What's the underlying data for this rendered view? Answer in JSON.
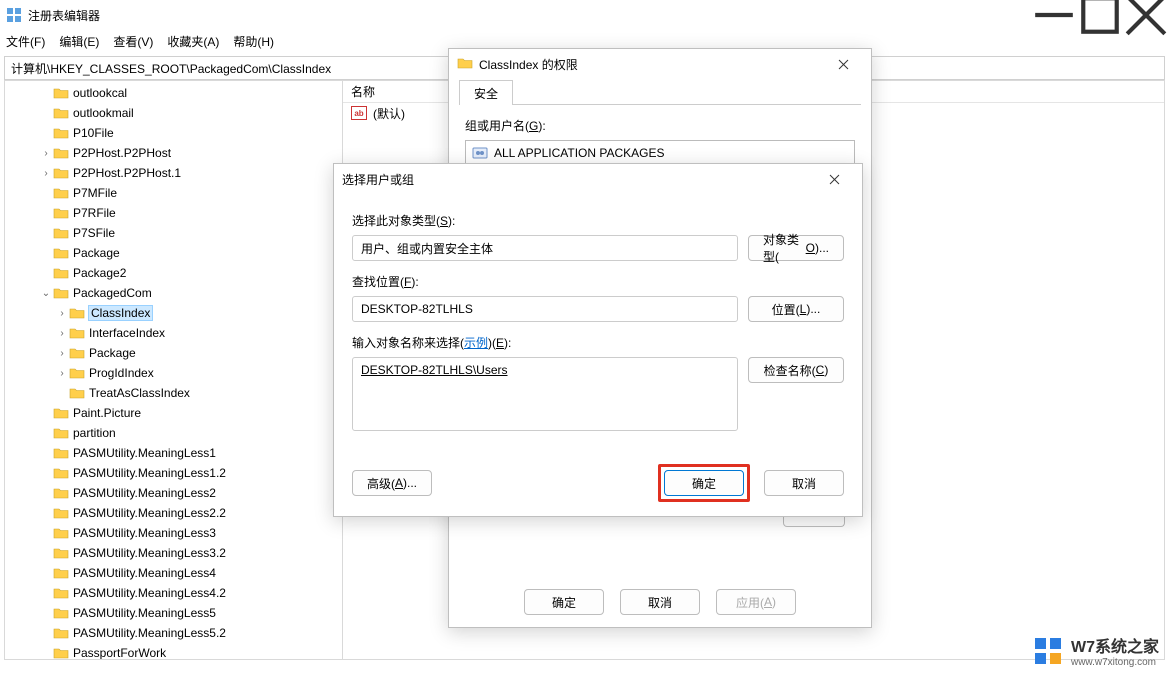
{
  "titlebar": {
    "title": "注册表编辑器"
  },
  "menubar": {
    "file": "文件(F)",
    "edit": "编辑(E)",
    "view": "查看(V)",
    "fav": "收藏夹(A)",
    "help": "帮助(H)"
  },
  "pathbar": {
    "path": "计算机\\HKEY_CLASSES_ROOT\\PackagedCom\\ClassIndex"
  },
  "values": {
    "col_name": "名称",
    "default_row": "(默认)"
  },
  "tree": {
    "items": [
      {
        "indent": 2,
        "exp": "",
        "label": "outlookcal"
      },
      {
        "indent": 2,
        "exp": "",
        "label": "outlookmail"
      },
      {
        "indent": 2,
        "exp": "",
        "label": "P10File"
      },
      {
        "indent": 2,
        "exp": ">",
        "label": "P2PHost.P2PHost"
      },
      {
        "indent": 2,
        "exp": ">",
        "label": "P2PHost.P2PHost.1"
      },
      {
        "indent": 2,
        "exp": "",
        "label": "P7MFile"
      },
      {
        "indent": 2,
        "exp": "",
        "label": "P7RFile"
      },
      {
        "indent": 2,
        "exp": "",
        "label": "P7SFile"
      },
      {
        "indent": 2,
        "exp": "",
        "label": "Package"
      },
      {
        "indent": 2,
        "exp": "",
        "label": "Package2"
      },
      {
        "indent": 2,
        "exp": "v",
        "label": "PackagedCom"
      },
      {
        "indent": 3,
        "exp": ">",
        "label": "ClassIndex",
        "selected": true
      },
      {
        "indent": 3,
        "exp": ">",
        "label": "InterfaceIndex"
      },
      {
        "indent": 3,
        "exp": ">",
        "label": "Package"
      },
      {
        "indent": 3,
        "exp": ">",
        "label": "ProgIdIndex"
      },
      {
        "indent": 3,
        "exp": "",
        "label": "TreatAsClassIndex"
      },
      {
        "indent": 2,
        "exp": "",
        "label": "Paint.Picture"
      },
      {
        "indent": 2,
        "exp": "",
        "label": "partition"
      },
      {
        "indent": 2,
        "exp": "",
        "label": "PASMUtility.MeaningLess1"
      },
      {
        "indent": 2,
        "exp": "",
        "label": "PASMUtility.MeaningLess1.2"
      },
      {
        "indent": 2,
        "exp": "",
        "label": "PASMUtility.MeaningLess2"
      },
      {
        "indent": 2,
        "exp": "",
        "label": "PASMUtility.MeaningLess2.2"
      },
      {
        "indent": 2,
        "exp": "",
        "label": "PASMUtility.MeaningLess3"
      },
      {
        "indent": 2,
        "exp": "",
        "label": "PASMUtility.MeaningLess3.2"
      },
      {
        "indent": 2,
        "exp": "",
        "label": "PASMUtility.MeaningLess4"
      },
      {
        "indent": 2,
        "exp": "",
        "label": "PASMUtility.MeaningLess4.2"
      },
      {
        "indent": 2,
        "exp": "",
        "label": "PASMUtility.MeaningLess5"
      },
      {
        "indent": 2,
        "exp": "",
        "label": "PASMUtility.MeaningLess5.2"
      },
      {
        "indent": 2,
        "exp": "",
        "label": "PassportForWork"
      }
    ]
  },
  "perm": {
    "title": "ClassIndex 的权限",
    "tab": "安全",
    "group_label_pre": "组或用户名(",
    "group_label_ul": "G",
    "group_label_post": "):",
    "list_item": "ALL APPLICATION PACKAGES",
    "ok": "确定",
    "cancel": "取消",
    "apply_pre": "应用(",
    "apply_ul": "A",
    "apply_post": ")"
  },
  "sel": {
    "title": "选择用户或组",
    "obj_type_label_pre": "选择此对象类型(",
    "obj_type_label_ul": "S",
    "obj_type_label_post": "):",
    "obj_type_value": "用户、组或内置安全主体",
    "obj_type_btn_pre": "对象类型(",
    "obj_type_btn_ul": "O",
    "obj_type_btn_post": ")...",
    "loc_label_pre": "查找位置(",
    "loc_label_ul": "F",
    "loc_label_post": "):",
    "loc_value": "DESKTOP-82TLHLS",
    "loc_btn_pre": "位置(",
    "loc_btn_ul": "L",
    "loc_btn_post": ")...",
    "name_label_pre": "输入对象名称来选择(",
    "name_label_link": "示例",
    "name_label_post_pre": ")(",
    "name_label_post_ul": "E",
    "name_label_post_post": "):",
    "name_value": "DESKTOP-82TLHLS\\Users",
    "check_btn_pre": "检查名称(",
    "check_btn_ul": "C",
    "check_btn_post": ")",
    "adv_btn_pre": "高级(",
    "adv_btn_ul": "A",
    "adv_btn_post": ")...",
    "ok": "确定",
    "cancel": "取消"
  },
  "watermark": {
    "title": "W7系统之家",
    "sub": "www.w7xitong.com"
  }
}
